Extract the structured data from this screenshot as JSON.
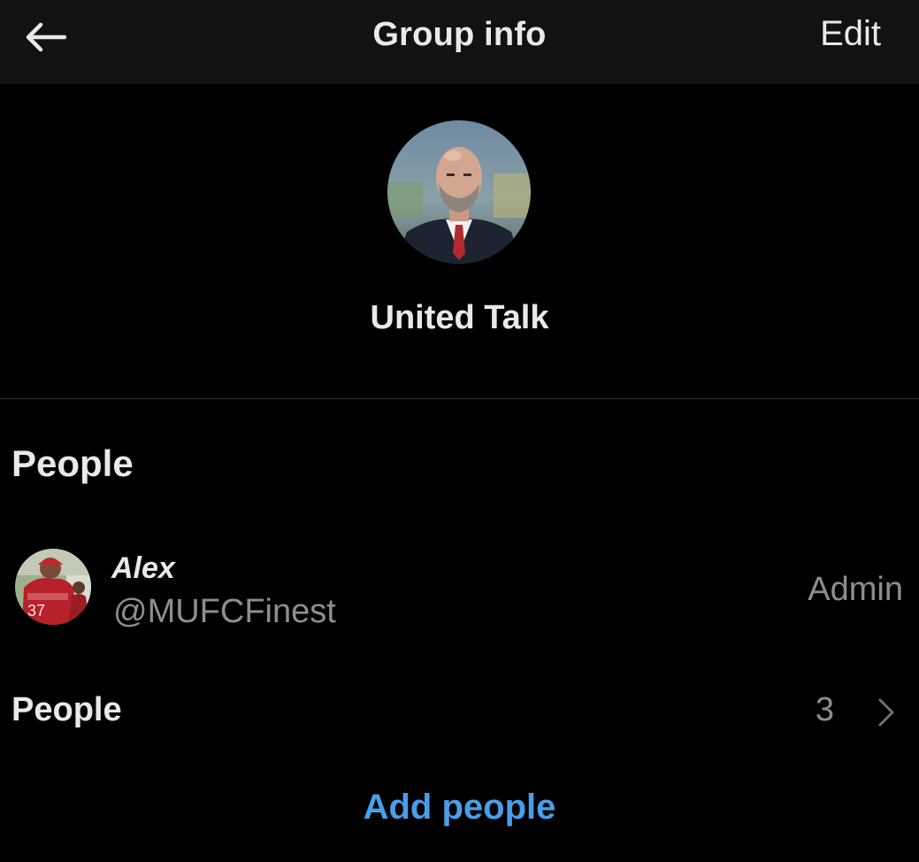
{
  "header": {
    "title": "Group info",
    "edit_label": "Edit",
    "back_icon": "arrow-left-icon"
  },
  "group": {
    "name": "United Talk",
    "avatar": "group-avatar-photo"
  },
  "people_section": {
    "heading": "People",
    "members": [
      {
        "name": "Alex",
        "handle": "@MUFCFinest",
        "role": "Admin",
        "avatar": "member-avatar-photo"
      }
    ],
    "count_row": {
      "label": "People",
      "count": "3",
      "chevron_icon": "chevron-right-icon"
    },
    "add_label": "Add people"
  },
  "colors": {
    "background": "#000000",
    "header_background": "#121212",
    "primary_text": "#e7e9ea",
    "secondary_text": "#8b8f93",
    "accent_link": "#4a9ee8",
    "divider": "#2f3336"
  }
}
